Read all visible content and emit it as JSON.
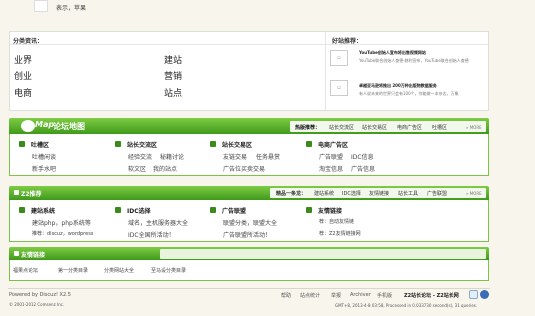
{
  "top": {
    "avatar_alt": "",
    "caption": "表示，苹果"
  },
  "categories": {
    "title": "分类资讯：",
    "items": [
      "业界",
      "建站",
      "创业",
      "营销",
      "电商",
      "站点"
    ]
  },
  "friends": {
    "title": "好站推荐：",
    "items": [
      {
        "title": "YouTube创始人宣布将出售视频网站",
        "desc": "YouTube联合创始人查德·赫利宣布，YouTube联合创始人查德"
      },
      {
        "title": "卓越亚马逊将推出 200万种出版物数据服务",
        "desc": "有人说未来的世界只会有100个，你能做一本杂志，万象"
      }
    ]
  },
  "forum_map": {
    "title_logo": "Map",
    "title": "论坛地图",
    "hot_label": "热版推荐：",
    "hot_links": [
      "站长交流区",
      "站长交易区",
      "电商广告区",
      "吐槽区"
    ],
    "more": "» MORE",
    "groups": [
      {
        "name": "吐槽区",
        "links": [
          "吐槽闲谈",
          "新手水吧"
        ]
      },
      {
        "name": "站长交流区",
        "links": [
          "经验交流",
          "秘籍讨论",
          "软文区",
          "我的站点"
        ]
      },
      {
        "name": "站长交易区",
        "links": [
          "友链交易",
          "任务悬赏",
          "广告位买卖交易"
        ]
      },
      {
        "name": "电商广告区",
        "links": [
          "广告联盟",
          "IDC信息",
          "淘宝信息",
          "广告信息"
        ]
      }
    ]
  },
  "z2": {
    "title": "Z2推荐",
    "right_label": "精品一条龙：",
    "right_links": [
      "建站系统",
      "IDC选择",
      "友情链接",
      "站长工具",
      "广告联盟"
    ],
    "more": "» MORE",
    "groups": [
      {
        "name": "建站系统",
        "line1": "建站php，php系统等",
        "line2": "推荐：discuz，wordpress"
      },
      {
        "name": "IDC选择",
        "line1": "域名，主机服务器大全",
        "line2": "IDC全国所活动！"
      },
      {
        "name": "广告联盟",
        "line1": "联盟分类，联盟大全",
        "line2": "广告联盟所活动！"
      },
      {
        "name": "友情链接",
        "line1": "荐：自动友情链",
        "line2": "荐：Z2友情链接网"
      }
    ]
  },
  "links": {
    "title": "友情链接",
    "items": [
      "福果点论坛",
      "第一分类目录",
      "分类网站大全",
      "至马设分类目录"
    ]
  },
  "footer": {
    "powered": "Powered by Discuz! X2.5",
    "copyright": "© 2001-2012 Comsenz Inc.",
    "nav": [
      "帮助",
      "站点统计",
      "举报",
      "Archiver",
      "手机版"
    ],
    "site": "Z2站长论坛 - Z2站长网",
    "stats": "GMT+8, 2013-4-8 03:58, Processed in 0.033730 second(s), 31 queries."
  }
}
